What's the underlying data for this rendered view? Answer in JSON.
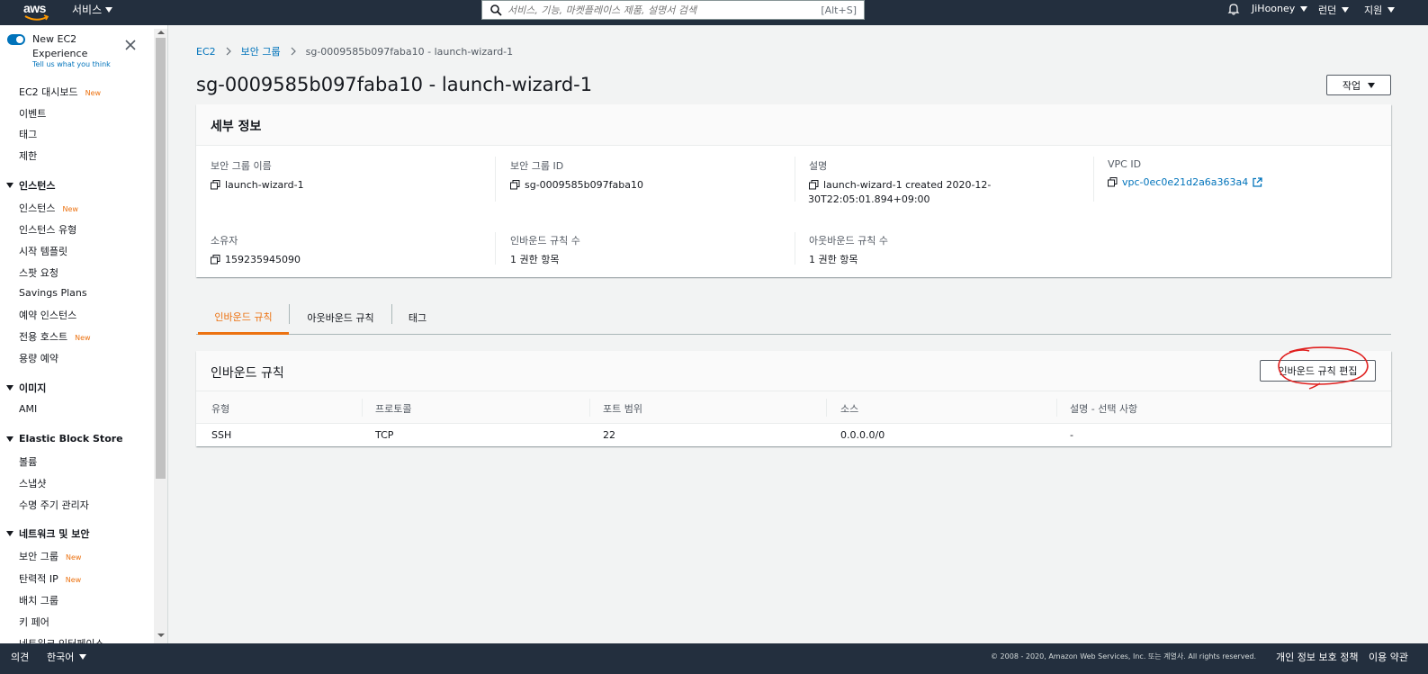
{
  "topbar": {
    "logo_text": "aws",
    "services_label": "서비스",
    "search_placeholder": "서비스, 기능, 마켓플레이스 제품, 설명서 검색",
    "search_shortcut": "[Alt+S]",
    "user": "JiHooney",
    "region": "런던",
    "support": "지원"
  },
  "sidebar": {
    "new_experience_title": "New EC2 Experience",
    "tell_us": "Tell us what you think",
    "new_badge": "New",
    "items_top": [
      "EC2 대시보드",
      "이벤트",
      "태그",
      "제한"
    ],
    "sections": [
      {
        "title": "인스턴스",
        "items": [
          "인스턴스",
          "인스턴스 유형",
          "시작 템플릿",
          "스팟 요청",
          "Savings Plans",
          "예약 인스턴스",
          "전용 호스트",
          "용량 예약"
        ]
      },
      {
        "title": "이미지",
        "items": [
          "AMI"
        ]
      },
      {
        "title": "Elastic Block Store",
        "items": [
          "볼륨",
          "스냅샷",
          "수명 주기 관리자"
        ]
      },
      {
        "title": "네트워크 및 보안",
        "items": [
          "보안 그룹",
          "탄력적 IP",
          "배치 그룹",
          "키 페어",
          "네트워크 인터페이스"
        ]
      }
    ]
  },
  "breadcrumb": {
    "root": "EC2",
    "parent": "보안 그룹",
    "current": "sg-0009585b097faba10 - launch-wizard-1"
  },
  "page": {
    "title": "sg-0009585b097faba10 - launch-wizard-1",
    "actions_label": "작업"
  },
  "details": {
    "header": "세부 정보",
    "fields": {
      "sg_name_label": "보안 그룹 이름",
      "sg_name": "launch-wizard-1",
      "sg_id_label": "보안 그룹 ID",
      "sg_id": "sg-0009585b097faba10",
      "desc_label": "설명",
      "desc_line1": "launch-wizard-1 created 2020-12-",
      "desc_line2": "30T22:05:01.894+09:00",
      "vpc_label": "VPC ID",
      "vpc": "vpc-0ec0e21d2a6a363a4",
      "owner_label": "소유자",
      "owner": "159235945090",
      "inbound_count_label": "인바운드 규칙 수",
      "inbound_count": "1 권한 항목",
      "outbound_count_label": "아웃바운드 규칙 수",
      "outbound_count": "1 권한 항목"
    }
  },
  "tabs": [
    "인바운드 규칙",
    "아웃바운드 규칙",
    "태그"
  ],
  "rules": {
    "header": "인바운드 규칙",
    "edit_button": "인바운드 규칙 편집",
    "columns": [
      "유형",
      "프로토콜",
      "포트 범위",
      "소스",
      "설명 - 선택 사항"
    ],
    "rows": [
      [
        "SSH",
        "TCP",
        "22",
        "0.0.0.0/0",
        "-"
      ]
    ]
  },
  "footer": {
    "feedback": "의견",
    "language": "한국어",
    "copyright": "© 2008 - 2020, Amazon Web Services, Inc. 또는 계열사. All rights reserved.",
    "privacy": "개인 정보 보호 정책",
    "terms": "이용 약관"
  },
  "colors": {
    "nav_bg": "#232f3e",
    "link": "#0073bb",
    "accent": "#ec7211",
    "annotation": "#e0201f"
  }
}
